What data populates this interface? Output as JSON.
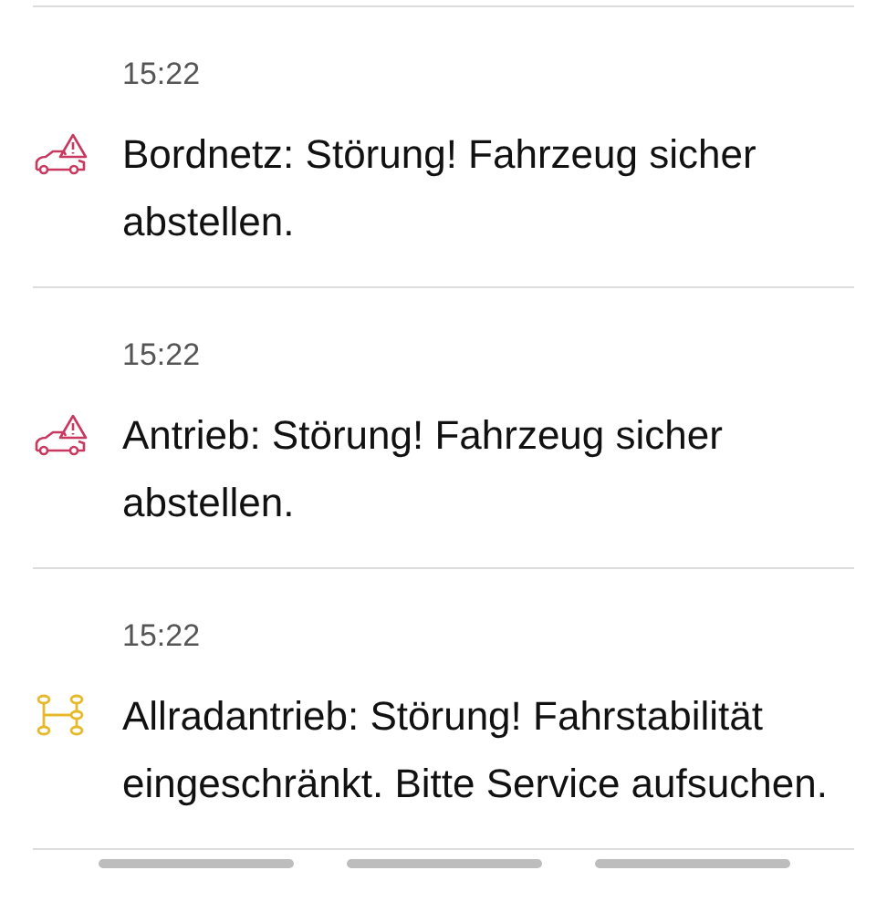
{
  "messages": [
    {
      "time": "15:22",
      "kind": "car-warning",
      "text": "Bordnetz: Störung! Fahrzeug sicher abstellen."
    },
    {
      "time": "15:22",
      "kind": "car-warning",
      "text": "Antrieb: Störung! Fahrzeug sicher abstellen."
    },
    {
      "time": "15:22",
      "kind": "drivetrain",
      "text": "Allradantrieb: Störung! Fahrstabilität eingeschränkt. Bitte Service aufsuchen."
    }
  ]
}
